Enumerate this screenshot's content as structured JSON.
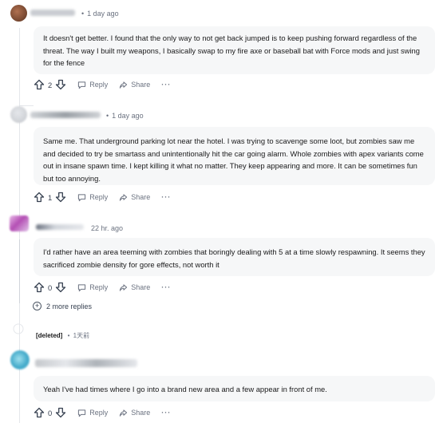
{
  "comments": [
    {
      "time": "1 day ago",
      "text": "It doesn't get better. I found that the only way to not get back jumped is to keep pushing forward regardless of the threat. The way I built my weapons, I basically swap to my fire axe or baseball bat with Force mods and just swing for the fence",
      "votes": "2",
      "reply_label": "Reply",
      "share_label": "Share",
      "more_label": "···"
    },
    {
      "time": "1 day ago",
      "text": "Same me. That underground parking lot near the hotel. I was trying to scavenge some loot, but zombies saw me and decided to try be smartass and unintentionally hit the car going alarm. Whole zombies with apex variants come out in insane spawn time. I kept killing it what no matter. They keep appearing and more. It can be sometimes fun but too annoying.",
      "votes": "1",
      "reply_label": "Reply",
      "share_label": "Share",
      "more_label": "···"
    },
    {
      "time": "22 hr. ago",
      "text": "I'd rather have an area teeming with zombies that boringly dealing with 5 at a time slowly respawning. It seems they sacrificed zombie density for gore effects, not worth it",
      "votes": "0",
      "reply_label": "Reply",
      "share_label": "Share",
      "more_label": "···"
    },
    {
      "time": "",
      "text": "Yeah I've had times where I go into a brand new area and a few appear in front of me.",
      "votes": "0",
      "reply_label": "Reply",
      "share_label": "Share",
      "more_label": "···"
    }
  ],
  "more_replies": {
    "icon": "+",
    "label": "2 more replies"
  },
  "deleted_comment": {
    "author": "[deleted]",
    "time": "1天前"
  },
  "colors": {
    "bubble_bg": "#f6f7f8",
    "meta_text": "#6b7280",
    "thread_line": "#e5e7eb",
    "avatar_1": "#7a4a2e",
    "avatar_3": "#b44fb4",
    "avatar_5": "#3ea7c8"
  }
}
